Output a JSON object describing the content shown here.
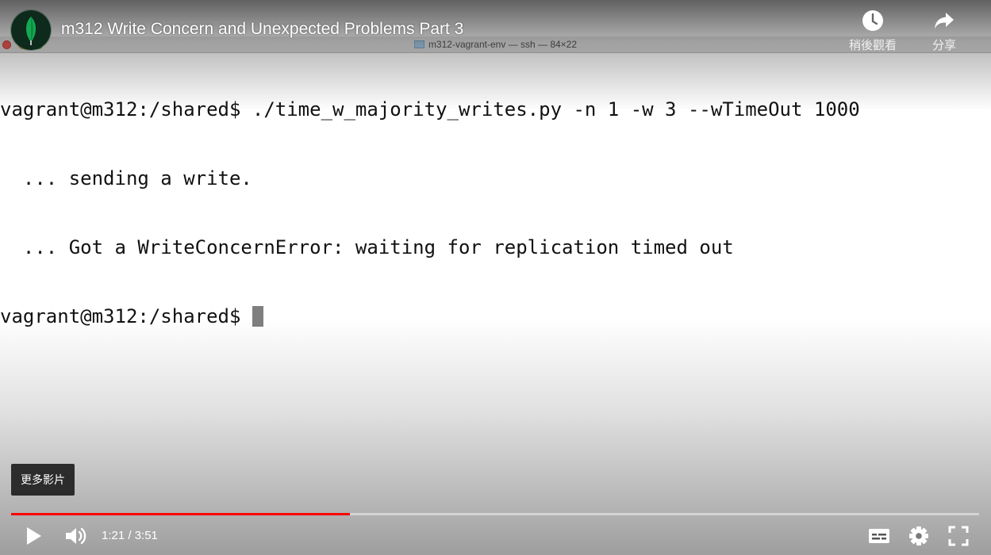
{
  "terminal": {
    "window_title": "m312-vagrant-env — ssh — 84×22",
    "lines": [
      "vagrant@m312:/shared$ ./time_w_majority_writes.py -n 1 -w 3 --wTimeOut 1000",
      "  ... sending a write.",
      "  ... Got a WriteConcernError: waiting for replication timed out",
      "vagrant@m312:/shared$ "
    ]
  },
  "video": {
    "title": "m312 Write Concern and Unexpected Problems Part 3",
    "current_time": "1:21",
    "duration": "3:51",
    "time_display": "1:21 / 3:51",
    "progress_fraction": 0.35
  },
  "top_controls": {
    "watch_later_label": "稍後觀看",
    "share_label": "分享"
  },
  "more_videos_label": "更多影片",
  "icons": {
    "channel_avatar": "leaf-logo-icon",
    "watch_later": "clock-icon",
    "share": "share-arrow-icon",
    "play": "play-icon",
    "volume": "volume-icon",
    "captions": "captions-icon",
    "settings": "gear-icon",
    "fullscreen": "fullscreen-icon"
  },
  "colors": {
    "progress": "#ff0000",
    "avatar_bg": "#13aa52",
    "traffic_red": "#ee5b53",
    "traffic_yellow": "#f1bc3f",
    "traffic_green": "#5ec545"
  }
}
